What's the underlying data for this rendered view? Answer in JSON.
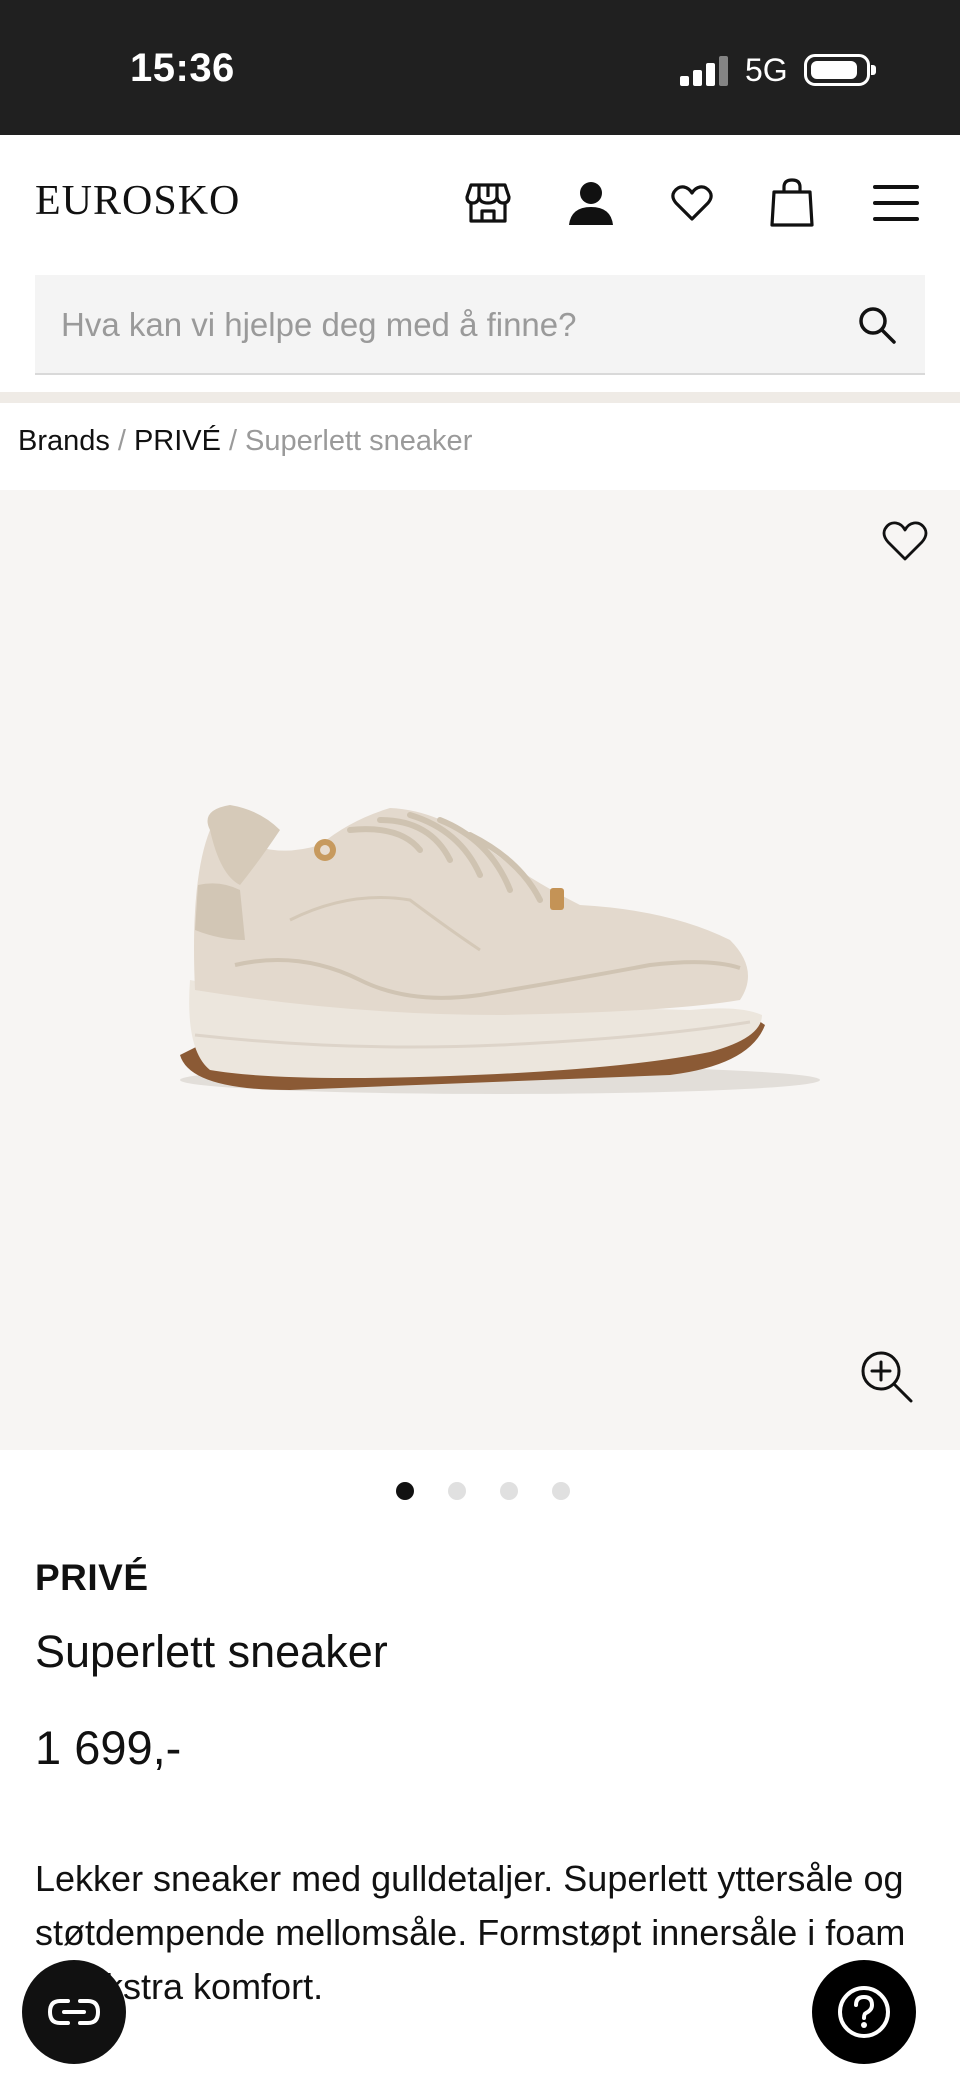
{
  "status_bar": {
    "time": "15:36",
    "network": "5G"
  },
  "header": {
    "logo": "EUROSKO",
    "icons": [
      "store-icon",
      "user-icon",
      "heart-icon",
      "bag-icon",
      "menu-icon"
    ]
  },
  "search": {
    "placeholder": "Hva kan vi hjelpe deg med å finne?"
  },
  "breadcrumb": {
    "items": [
      "Brands",
      "PRIVÉ"
    ],
    "separator": "/",
    "current": "Superlett sneaker"
  },
  "gallery": {
    "image_count": 4,
    "active_index": 0
  },
  "product": {
    "brand": "PRIVÉ",
    "name": "Superlett sneaker",
    "price": "1 699,-",
    "description": "Lekker sneaker med gulldetaljer. Superlett yttersåle og støtdempende mellomsåle. Formstøpt innersåle i foam gir ekstra komfort."
  },
  "colors": {
    "status_bar": "#202020",
    "image_bg": "#f7f5f3",
    "band": "#efebe6",
    "accent": "#111111"
  }
}
